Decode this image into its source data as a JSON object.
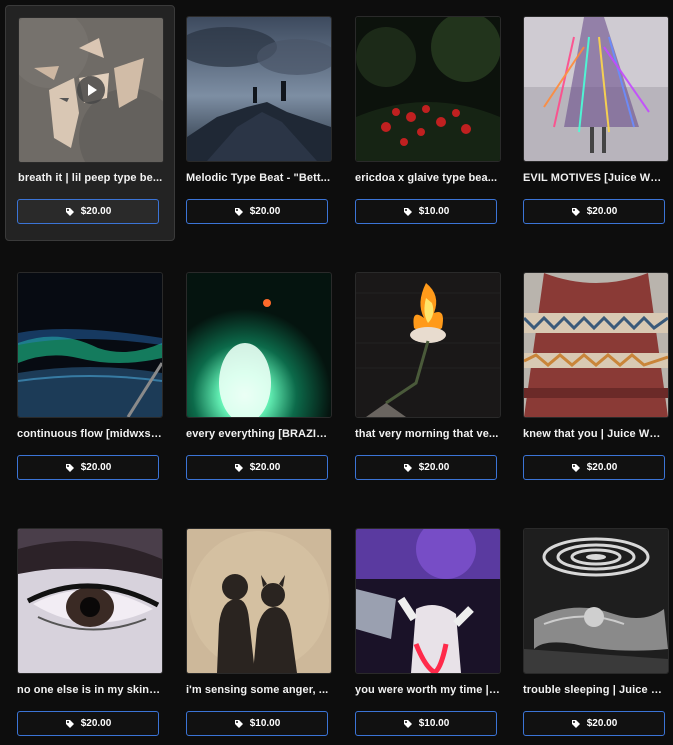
{
  "products": [
    {
      "title": "breath it | lil peep type be...",
      "price": "$20.00",
      "thumb": "broken-mask"
    },
    {
      "title": "Melodic Type Beat - \"Bett...",
      "price": "$20.00",
      "thumb": "storm-rocks"
    },
    {
      "title": "ericdoa x glaive type bea...",
      "price": "$10.00",
      "thumb": "red-flowers-forest"
    },
    {
      "title": "EVIL MOTIVES [Juice WRLD...",
      "price": "$20.00",
      "thumb": "rainbow-dress"
    },
    {
      "title": "continuous flow [midwxst...",
      "price": "$20.00",
      "thumb": "aurora-earth"
    },
    {
      "title": "every everything [BRAZILI...",
      "price": "$20.00",
      "thumb": "glowing-figure"
    },
    {
      "title": "that very morning that ve...",
      "price": "$20.00",
      "thumb": "burning-roses"
    },
    {
      "title": "knew that you | Juice WRL...",
      "price": "$20.00",
      "thumb": "knit-sweater"
    },
    {
      "title": "no one else is in my skin | ...",
      "price": "$20.00",
      "thumb": "eye-closeup"
    },
    {
      "title": "i'm sensing some anger, ...",
      "price": "$10.00",
      "thumb": "shadow-couple"
    },
    {
      "title": "you were worth my time | ...",
      "price": "$10.00",
      "thumb": "neon-couple"
    },
    {
      "title": "trouble sleeping | Juice W...",
      "price": "$20.00",
      "thumb": "spiral-sleeper"
    }
  ],
  "icons": {
    "price": "price-tag-icon",
    "play": "play-icon"
  },
  "colors": {
    "background": "#0d0d0d",
    "button_border": "#3b74d6",
    "hover_card": "#232323"
  }
}
